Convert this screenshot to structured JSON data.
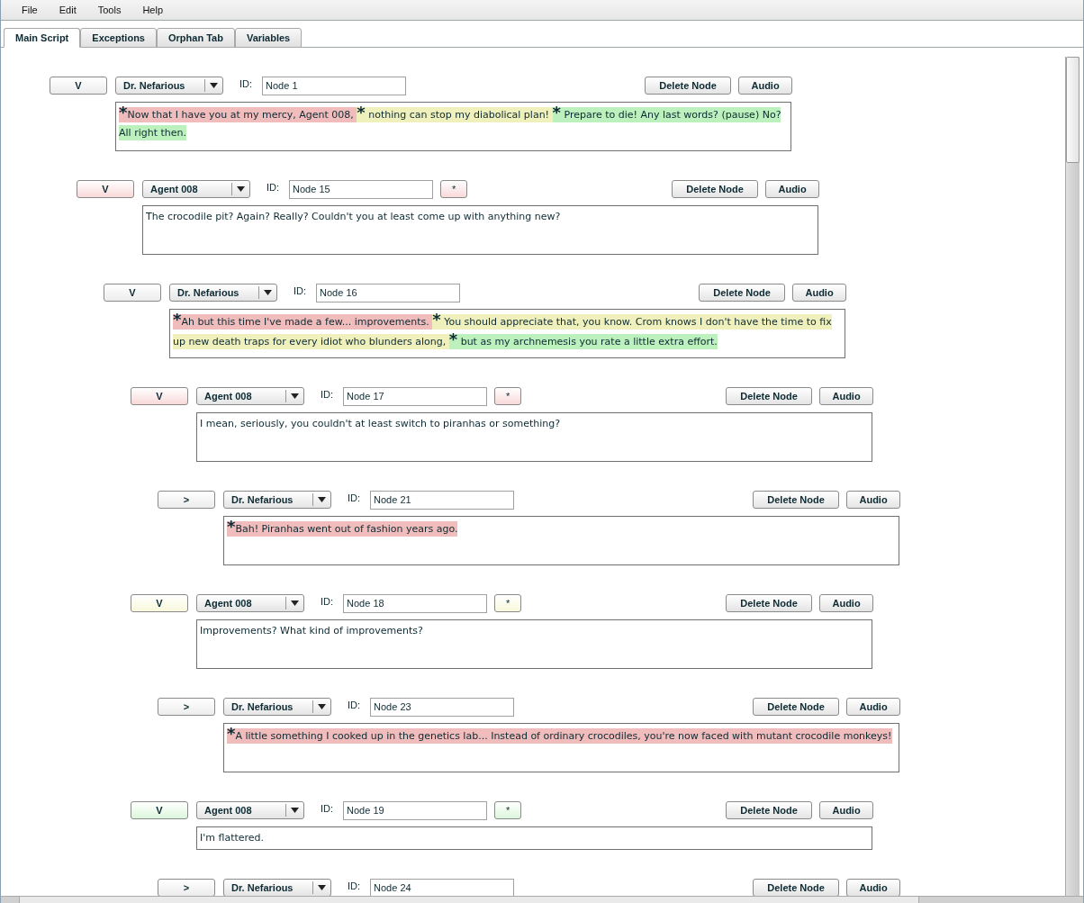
{
  "menu": [
    "File",
    "Edit",
    "Tools",
    "Help"
  ],
  "tabs": [
    {
      "label": "Main Script",
      "selected": true
    },
    {
      "label": "Exceptions",
      "selected": false
    },
    {
      "label": "Orphan Tab",
      "selected": false
    },
    {
      "label": "Variables",
      "selected": false
    }
  ],
  "nodes": [
    {
      "toggle": "V",
      "color": "#ececec",
      "speaker": "Dr. Nefarious",
      "id_label": "ID:",
      "id": "Node 1",
      "delete_label": "Delete Node",
      "audio_label": "Audio",
      "kind": "tall",
      "segments": [
        {
          "marker": "*",
          "text": "Now that I have you at my mercy, Agent 008, ",
          "color": "#f0bcbc"
        },
        {
          "marker": "*",
          "text": " nothing can stop my diabolical plan! ",
          "color": "#f0f0bc"
        },
        {
          "marker": "*",
          "text": " Prepare to die! Any last words?  (pause) No? All right then.",
          "color": "#bcf0bc"
        }
      ],
      "children": [
        {
          "toggle": "V",
          "color": "#f8d8d8",
          "speaker": "Agent 008",
          "id_label": "ID:",
          "id": "Node 15",
          "star": "*",
          "delete_label": "Delete Node",
          "audio_label": "Audio",
          "kind": "tall",
          "text": "The crocodile pit? Again? Really? Couldn't you at least come up with anything new?",
          "children": [
            {
              "toggle": "V",
              "color": "#ececec",
              "speaker": "Dr. Nefarious",
              "id_label": "ID:",
              "id": "Node 16",
              "delete_label": "Delete Node",
              "audio_label": "Audio",
              "kind": "tall",
              "segments": [
                {
                  "marker": "*",
                  "text": "Ah but this time I've made a few... improvements. ",
                  "color": "#f0bcbc"
                },
                {
                  "marker": "*",
                  "text": " You should appreciate that, you know. Crom knows I don't have the time to fix up new death traps for every idiot who blunders along, ",
                  "color": "#f0f0bc"
                },
                {
                  "marker": "*",
                  "text": " but as my archnemesis you rate a little extra effort.",
                  "color": "#bcf0bc"
                }
              ],
              "children": [
                {
                  "toggle": "V",
                  "color": "#f8d8d8",
                  "speaker": "Agent 008",
                  "id_label": "ID:",
                  "id": "Node 17",
                  "star": "*",
                  "delete_label": "Delete Node",
                  "audio_label": "Audio",
                  "kind": "tall",
                  "text": "I mean, seriously, you couldn't at least switch to piranhas or something?",
                  "children": [
                    {
                      "toggle": ">",
                      "color": "#ececec",
                      "speaker": "Dr. Nefarious",
                      "id_label": "ID:",
                      "id": "Node 21",
                      "delete_label": "Delete Node",
                      "audio_label": "Audio",
                      "kind": "tall",
                      "segments": [
                        {
                          "marker": "*",
                          "text": "Bah! Piranhas went out of fashion years ago.",
                          "color": "#f0bcbc"
                        }
                      ]
                    }
                  ]
                },
                {
                  "toggle": "V",
                  "color": "#f8f8dc",
                  "speaker": "Agent 008",
                  "id_label": "ID:",
                  "id": "Node 18",
                  "star": "*",
                  "delete_label": "Delete Node",
                  "audio_label": "Audio",
                  "kind": "tall",
                  "text": "Improvements? What kind of improvements?",
                  "children": [
                    {
                      "toggle": ">",
                      "color": "#ececec",
                      "speaker": "Dr. Nefarious",
                      "id_label": "ID:",
                      "id": "Node 23",
                      "delete_label": "Delete Node",
                      "audio_label": "Audio",
                      "kind": "tall",
                      "segments": [
                        {
                          "marker": "*",
                          "text": "A little something I cooked up in the genetics lab... Instead of ordinary crocodiles, you're now faced with mutant crocodile monkeys!",
                          "color": "#f0bcbc"
                        }
                      ]
                    }
                  ]
                },
                {
                  "toggle": "V",
                  "color": "#dcf6dc",
                  "speaker": "Agent 008",
                  "id_label": "ID:",
                  "id": "Node 19",
                  "star": "*",
                  "delete_label": "Delete Node",
                  "audio_label": "Audio",
                  "kind": "short",
                  "text": "I'm flattered.",
                  "children": [
                    {
                      "toggle": ">",
                      "color": "#ececec",
                      "speaker": "Dr. Nefarious",
                      "id_label": "ID:",
                      "id": "Node 24",
                      "delete_label": "Delete Node",
                      "audio_label": "Audio"
                    }
                  ]
                }
              ]
            }
          ]
        }
      ]
    }
  ]
}
